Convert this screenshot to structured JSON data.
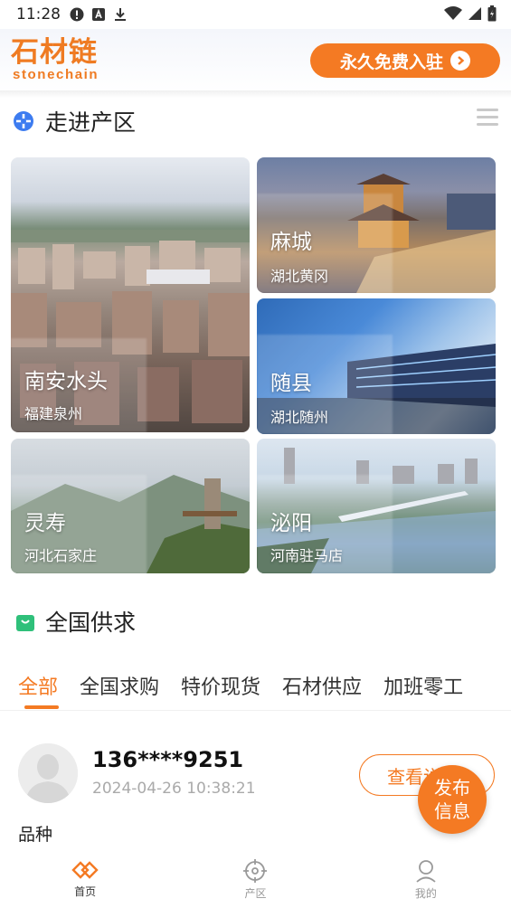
{
  "status_bar": {
    "time": "11:28"
  },
  "header": {
    "logo_cn": "石材链",
    "logo_en": "stonechain",
    "join_button": "永久免费入驻"
  },
  "regions_section": {
    "title": "走进产区",
    "regions": [
      {
        "name": "南安水头",
        "location": "福建泉州"
      },
      {
        "name": "麻城",
        "location": "湖北黄冈"
      },
      {
        "name": "随县",
        "location": "湖北随州"
      },
      {
        "name": "灵寿",
        "location": "河北石家庄"
      },
      {
        "name": "泌阳",
        "location": "河南驻马店"
      }
    ]
  },
  "supply_section": {
    "title": "全国供求",
    "tabs": [
      "全部",
      "全国求购",
      "特价现货",
      "石材供应",
      "加班零工"
    ],
    "active_tab": "全部"
  },
  "listing": {
    "phone": "136****9251",
    "time": "2024-04-26 10:38:21",
    "view_button": "查看详情",
    "variety_label": "品种"
  },
  "fab": {
    "line1": "发布",
    "line2": "信息"
  },
  "bottom_nav": {
    "items": [
      {
        "label": "首页",
        "icon": "home-icon"
      },
      {
        "label": "产区",
        "icon": "target-icon"
      },
      {
        "label": "我的",
        "icon": "user-icon"
      }
    ]
  },
  "colors": {
    "accent": "#f47a23",
    "logo": "#ef7b22"
  }
}
